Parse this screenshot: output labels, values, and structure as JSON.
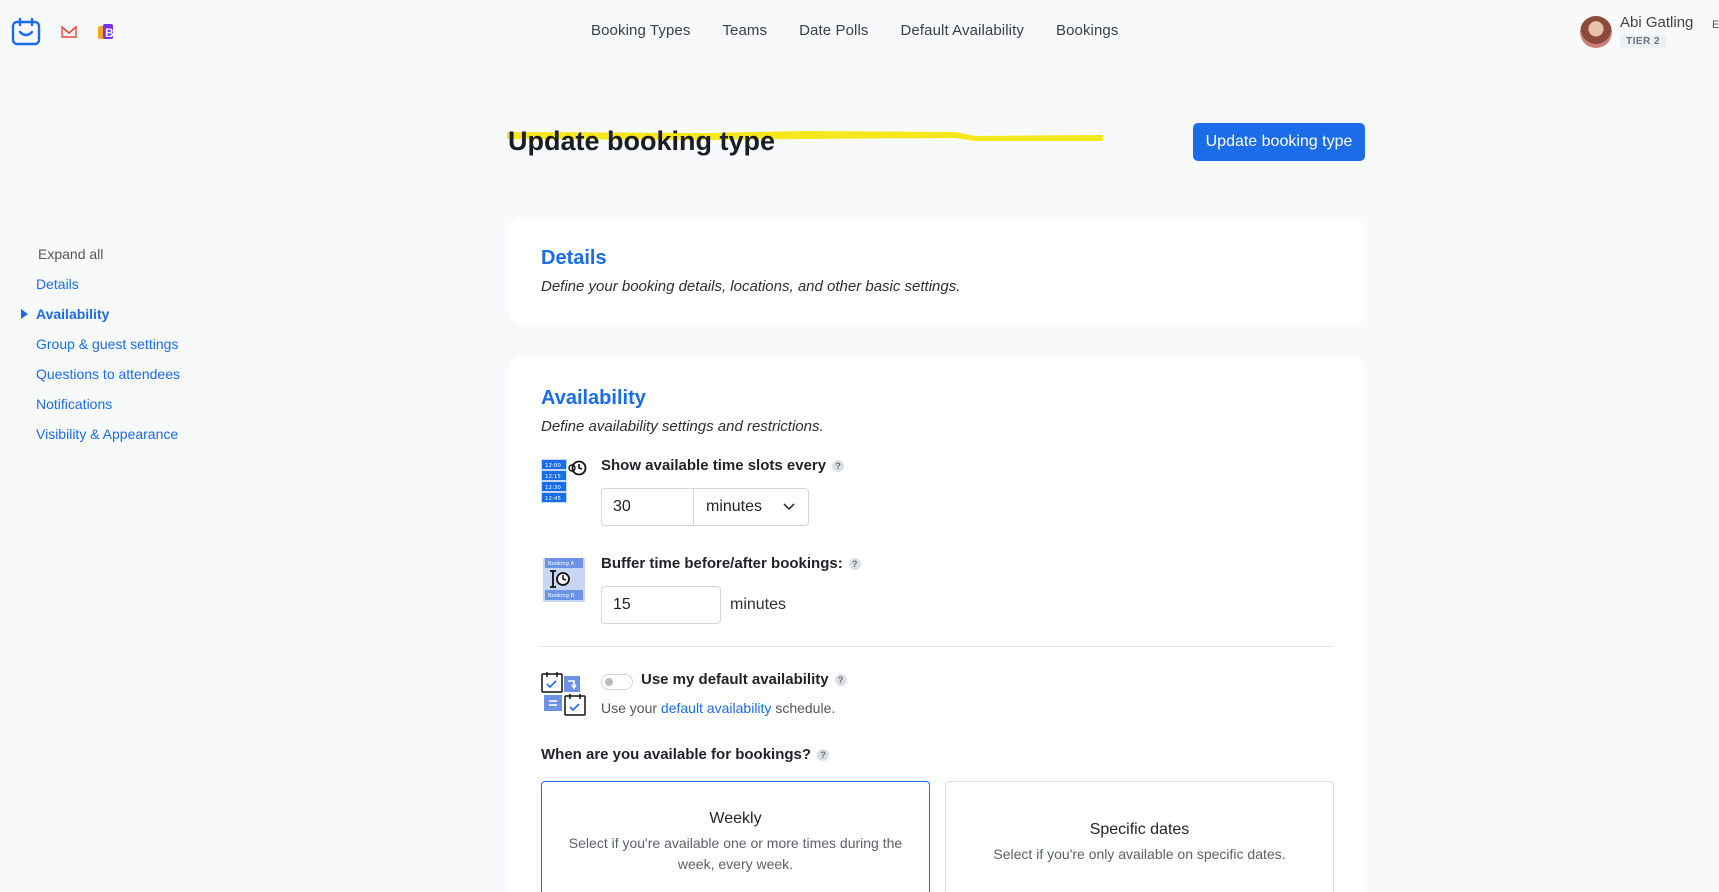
{
  "nav": {
    "items": [
      "Booking Types",
      "Teams",
      "Date Polls",
      "Default Availability",
      "Bookings"
    ]
  },
  "user": {
    "name": "Abi Gatling",
    "tier": "TIER 2"
  },
  "edge_letter": "E",
  "page": {
    "title": "Update booking type",
    "submit_label": "Update booking type",
    "accent_color": "#1a6ce8",
    "highlight_color": "#f5e81a"
  },
  "sidebar": {
    "expand_label": "Expand all",
    "items": [
      {
        "label": "Details",
        "active": false
      },
      {
        "label": "Availability",
        "active": true
      },
      {
        "label": "Group & guest settings",
        "active": false
      },
      {
        "label": "Questions to attendees",
        "active": false
      },
      {
        "label": "Notifications",
        "active": false
      },
      {
        "label": "Visibility & Appearance",
        "active": false
      }
    ]
  },
  "details": {
    "title": "Details",
    "subtitle": "Define your booking details, locations, and other basic settings."
  },
  "availability": {
    "title": "Availability",
    "subtitle": "Define availability settings and restrictions.",
    "timeslots": {
      "label": "Show available time slots every",
      "value": "30",
      "unit_selected": "minutes",
      "help": "?",
      "icon_times": [
        "12:00",
        "12:15",
        "12:30",
        "12:45"
      ]
    },
    "buffer": {
      "label": "Buffer time before/after bookings:",
      "value": "15",
      "unit": "minutes",
      "help": "?",
      "icon_labels": [
        "Booking A",
        "Booking B"
      ]
    },
    "default_availability": {
      "label": "Use my default availability",
      "enabled": false,
      "help": "?",
      "helper_prefix": "Use your",
      "helper_link": "default availability",
      "helper_suffix": "schedule."
    },
    "question": {
      "label": "When are you available for bookings?",
      "help": "?"
    },
    "options": [
      {
        "title": "Weekly",
        "description": "Select if you're available one or more times during the week, every week.",
        "selected": true
      },
      {
        "title": "Specific dates",
        "description": "Select if you're only available on specific dates.",
        "selected": false
      }
    ]
  }
}
